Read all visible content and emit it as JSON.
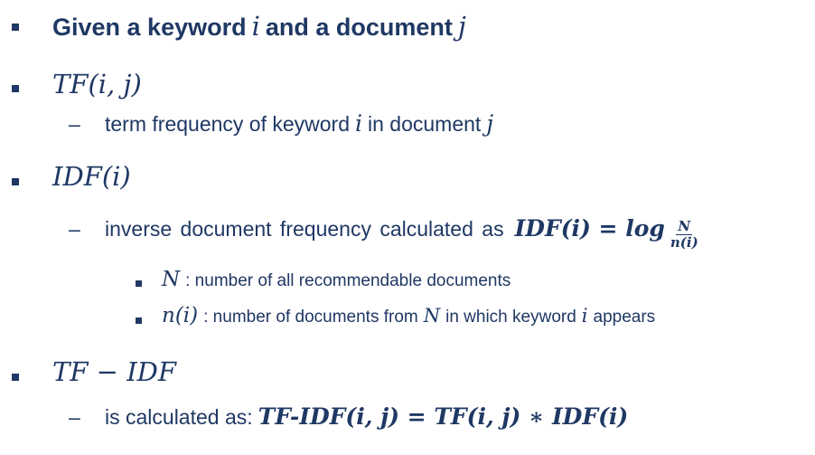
{
  "items": {
    "given": {
      "text_a": "Given a keyword",
      "var_i": "i",
      "text_b": "and a document",
      "var_j": "j"
    },
    "tf": {
      "term": "TF(i, j)",
      "desc_a": "term frequency of keyword",
      "var_i": "i",
      "desc_b": "in document",
      "var_j": "j"
    },
    "idf": {
      "term": "IDF(i)",
      "desc": "inverse document frequency calculated as",
      "formula_lhs": "IDF(i) = log",
      "frac_num": "N",
      "frac_den": "n(i)",
      "sub_n_var": "N",
      "sub_n_desc": ": number of all recommendable documents",
      "sub_ni_var": "n(i)",
      "sub_ni_desc_a": ": number of documents from",
      "sub_ni_var_N": "N",
      "sub_ni_desc_b": "in which keyword",
      "sub_ni_var_i": "i",
      "sub_ni_desc_c": "appears"
    },
    "tfidf": {
      "term": "TF − IDF",
      "desc": "is calculated as:",
      "formula": "TF-IDF(i, j) = TF(i, j) ∗ IDF(i)"
    }
  },
  "colors": {
    "text": "#1f3864"
  }
}
